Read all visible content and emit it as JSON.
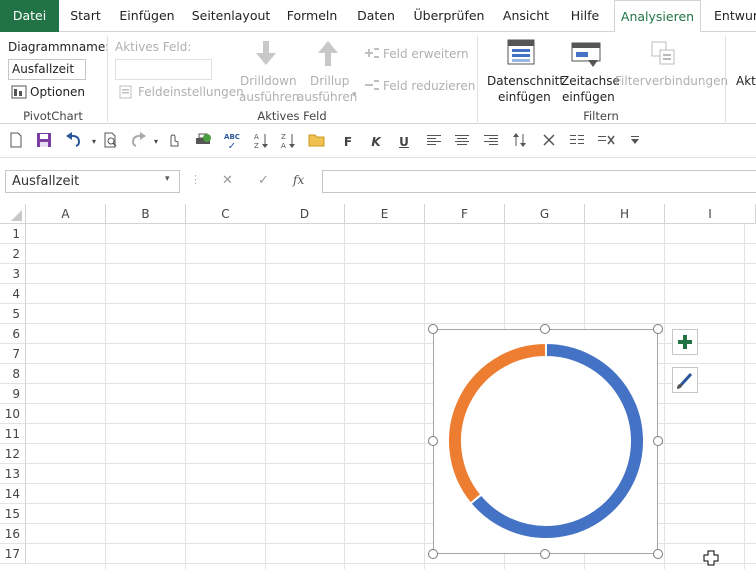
{
  "tabs": {
    "file": "Datei",
    "start": "Start",
    "insert": "Einfügen",
    "layout": "Seitenlayout",
    "formulas": "Formeln",
    "data": "Daten",
    "review": "Überprüfen",
    "view": "Ansicht",
    "help": "Hilfe",
    "analyze": "Analysieren",
    "design": "Entwurf"
  },
  "ribbon": {
    "chart_name_label": "Diagrammname:",
    "chart_name_value": "Ausfallzeit",
    "options_label": "Optionen",
    "group_pivotchart": "PivotChart",
    "active_field_label": "Aktives Feld:",
    "field_settings": "Feldeinstellungen",
    "drilldown_1": "Drilldown",
    "drilldown_2": "ausführen",
    "drillup_1": "Drillup",
    "drillup_2": "ausführen",
    "expand_field": "Feld erweitern",
    "collapse_field": "Feld reduzieren",
    "group_active_field": "Aktives Feld",
    "slicer_1": "Datenschnitt",
    "slicer_2": "einfügen",
    "timeline_1": "Zeitachse",
    "timeline_2": "einfügen",
    "filter_connections": "Filterverbindungen",
    "group_filter": "Filtern",
    "refresh_partial": "Akt"
  },
  "qat": {
    "bold": "F",
    "italic": "K",
    "underline": "U",
    "spell": "ABC"
  },
  "formula_bar": {
    "name_box": "Ausfallzeit",
    "fx": "fx",
    "cancel": "✕",
    "enter": "✓"
  },
  "columns": [
    "A",
    "B",
    "C",
    "D",
    "E",
    "F",
    "G",
    "H",
    "I"
  ],
  "rows": [
    "1",
    "2",
    "3",
    "4",
    "5",
    "6",
    "7",
    "8",
    "9",
    "10",
    "11",
    "12",
    "13",
    "14",
    "15",
    "16",
    "17"
  ],
  "chart_data": {
    "type": "pie",
    "variant": "doughnut",
    "slices": [
      {
        "value": 0.64,
        "color": "#4472c4"
      },
      {
        "value": 0.36,
        "color": "#ed7d31"
      }
    ],
    "title": "",
    "legend": "none"
  },
  "colors": {
    "excel_green": "#217346",
    "series_blue": "#4472c4",
    "series_orange": "#ed7d31"
  }
}
